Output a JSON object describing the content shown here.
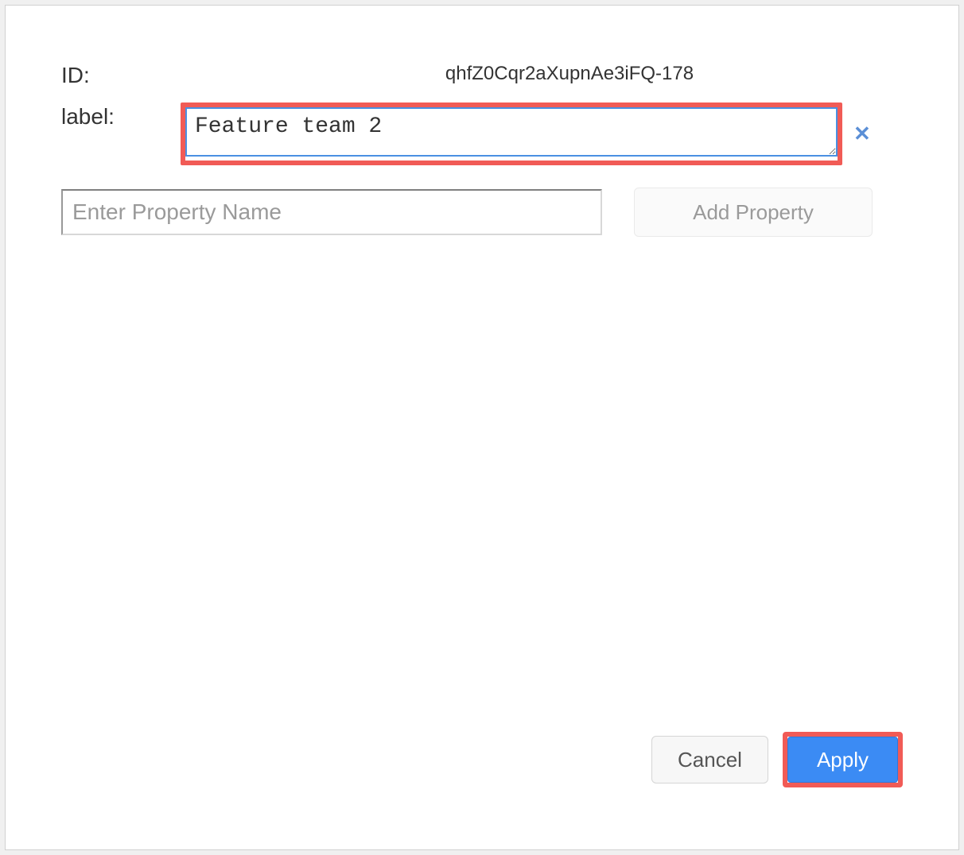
{
  "form": {
    "id_label": "ID:",
    "id_value": "qhfZ0Cqr2aXupnAe3iFQ-178",
    "label_label": "label:",
    "label_value": "Feature team 2",
    "property_placeholder": "Enter Property Name",
    "add_property_label": "Add Property"
  },
  "footer": {
    "cancel_label": "Cancel",
    "apply_label": "Apply"
  },
  "highlight_color": "#f15b56",
  "primary_color": "#3b8bf4"
}
